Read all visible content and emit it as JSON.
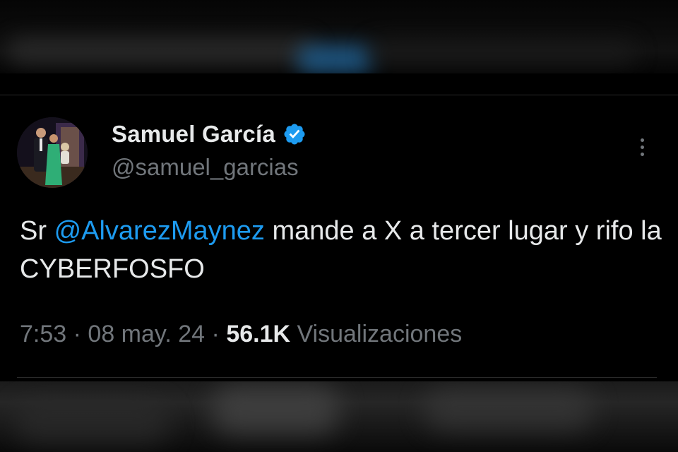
{
  "tweet": {
    "author": {
      "display_name": "Samuel García",
      "handle": "@samuel_garcias",
      "verified_icon": "verified-badge-icon"
    },
    "text": {
      "prefix": "Sr ",
      "mention": "@AlvarezMaynez",
      "suffix": " mande a X a tercer lugar y rifo la CYBERFOSFO"
    },
    "meta": {
      "time": "7:53",
      "separator": " · ",
      "date": "08 may. 24",
      "views_count": "56.1K",
      "views_label": " Visualizaciones"
    },
    "more_icon": "more-options-icon"
  },
  "colors": {
    "background": "#000000",
    "text_primary": "#e7e9ea",
    "text_secondary": "#71767b",
    "link": "#1d9bf0",
    "verified": "#1d9bf0"
  }
}
